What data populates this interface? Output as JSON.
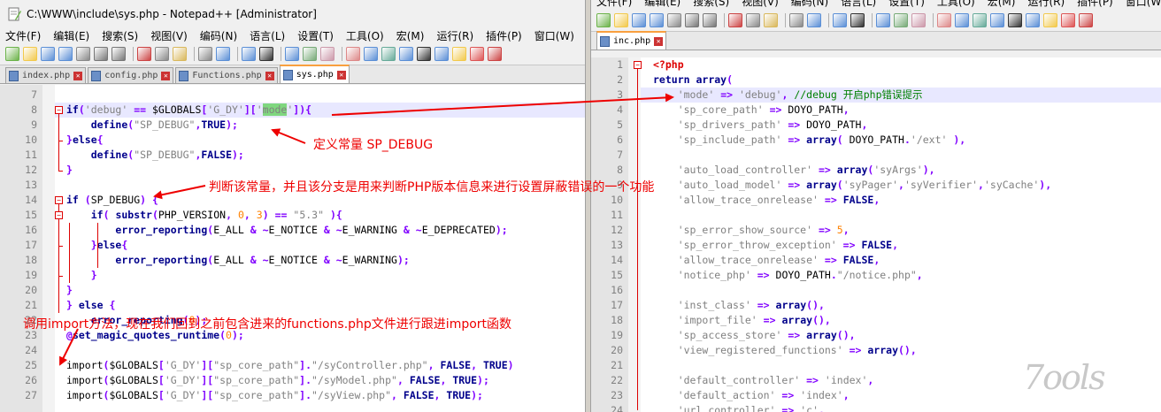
{
  "left_window": {
    "title": "C:\\WWW\\include\\sys.php - Notepad++ [Administrator]",
    "menu": [
      "文件(F)",
      "编辑(E)",
      "搜索(S)",
      "视图(V)",
      "编码(N)",
      "语言(L)",
      "设置(T)",
      "工具(O)",
      "宏(M)",
      "运行(R)",
      "插件(P)",
      "窗口(W)",
      "?"
    ],
    "tabs": [
      "index.php",
      "config.php",
      "Functions.php",
      "sys.php"
    ],
    "active_tab": "sys.php",
    "lines": [
      {
        "n": "7",
        "html": ""
      },
      {
        "n": "8",
        "html": "<span class='kw'>if</span><span class='op'>(</span><span class='st'>'debug'</span> <span class='op'>==</span> $GLOBALS<span class='op'>[</span><span class='st'>'G_DY'</span><span class='op'>][</span><span class='st'>'<span class=\"hl\">mode</span>'</span><span class='op'>]){</span>"
      },
      {
        "n": "9",
        "html": "    <span class='kw'>define</span><span class='op'>(</span><span class='st'>\"SP_DEBUG\"</span><span class='op'>,</span><span class='kw'>TRUE</span><span class='op'>);</span>"
      },
      {
        "n": "10",
        "html": "<span class='op'>}</span><span class='kw'>else</span><span class='op'>{</span>"
      },
      {
        "n": "11",
        "html": "    <span class='kw'>define</span><span class='op'>(</span><span class='st'>\"SP_DEBUG\"</span><span class='op'>,</span><span class='kw'>FALSE</span><span class='op'>);</span>"
      },
      {
        "n": "12",
        "html": "<span class='op'>}</span>"
      },
      {
        "n": "13",
        "html": ""
      },
      {
        "n": "14",
        "html": "<span class='kw'>if</span> <span class='op'>(</span>SP_DEBUG<span class='op'>)</span> <span class='op'>{</span>"
      },
      {
        "n": "15",
        "html": "    <span class='kw'>if</span><span class='op'>(</span> <span class='kw'>substr</span><span class='op'>(</span>PHP_VERSION<span class='op'>,</span> <span class='nm'>0</span><span class='op'>,</span> <span class='nm'>3</span><span class='op'>)</span> <span class='op'>==</span> <span class='st'>\"5.3\"</span> <span class='op'>){</span>"
      },
      {
        "n": "16",
        "html": "        <span class='kw'>error_reporting</span><span class='op'>(</span>E_ALL <span class='op'>&amp;</span> <span class='op'>~</span>E_NOTICE <span class='op'>&amp;</span> <span class='op'>~</span>E_WARNING <span class='op'>&amp;</span> <span class='op'>~</span>E_DEPRECATED<span class='op'>);</span>"
      },
      {
        "n": "17",
        "html": "    <span class='op'>}</span><span class='kw'>else</span><span class='op'>{</span>"
      },
      {
        "n": "18",
        "html": "        <span class='kw'>error_reporting</span><span class='op'>(</span>E_ALL <span class='op'>&amp;</span> <span class='op'>~</span>E_NOTICE <span class='op'>&amp;</span> <span class='op'>~</span>E_WARNING<span class='op'>);</span>"
      },
      {
        "n": "19",
        "html": "    <span class='op'>}</span>"
      },
      {
        "n": "20",
        "html": "<span class='op'>}</span>"
      },
      {
        "n": "21",
        "html": "<span class='op'>}</span> <span class='kw'>else</span> <span class='op'>{</span>"
      },
      {
        "n": "22",
        "html": "    <span class='kw'>error_reporting</span><span class='op'>(</span><span class='nm'>0</span><span class='op'>);</span>"
      },
      {
        "n": "23",
        "html": "<span class='op'>@</span><span class='kw'>set_magic_quotes_runtime</span><span class='op'>(</span><span class='nm'>0</span><span class='op'>);</span>"
      },
      {
        "n": "24",
        "html": ""
      },
      {
        "n": "25",
        "html": "import<span class='op'>(</span>$GLOBALS<span class='op'>[</span><span class='st'>'G_DY'</span><span class='op'>][</span><span class='st'>\"sp_core_path\"</span><span class='op'>].</span><span class='st'>\"/syController.php\"</span><span class='op'>,</span> <span class='kw'>FALSE</span><span class='op'>,</span> <span class='kw'>TRUE</span><span class='op'>)</span>"
      },
      {
        "n": "26",
        "html": "import<span class='op'>(</span>$GLOBALS<span class='op'>[</span><span class='st'>'G_DY'</span><span class='op'>][</span><span class='st'>\"sp_core_path\"</span><span class='op'>].</span><span class='st'>\"/syModel.php\"</span><span class='op'>,</span> <span class='kw'>FALSE</span><span class='op'>,</span> <span class='kw'>TRUE</span><span class='op'>);</span>"
      },
      {
        "n": "27",
        "html": "import<span class='op'>(</span>$GLOBALS<span class='op'>[</span><span class='st'>'G_DY'</span><span class='op'>][</span><span class='st'>\"sp_core_path\"</span><span class='op'>].</span><span class='st'>\"/syView.php\"</span><span class='op'>,</span> <span class='kw'>FALSE</span><span class='op'>,</span> <span class='kw'>TRUE</span><span class='op'>);</span>"
      }
    ]
  },
  "right_window": {
    "menu": [
      "文件(F)",
      "编辑(E)",
      "搜索(S)",
      "视图(V)",
      "编码(N)",
      "语言(L)",
      "设置(T)",
      "工具(O)",
      "宏(M)",
      "运行(R)",
      "插件(P)",
      "窗口(W)"
    ],
    "tabs": [
      "inc.php"
    ],
    "active_tab": "inc.php",
    "lines": [
      {
        "n": "1",
        "html": "<span class='op' style='color:#d00'>&lt;?php</span>"
      },
      {
        "n": "2",
        "html": "<span class='kw'>return</span> <span class='kw'>array</span><span class='op'>(</span>"
      },
      {
        "n": "3",
        "html": "    <span class='st'>'mode'</span> <span class='op'>=&gt;</span> <span class='st'>'debug'</span><span class='op'>,</span> <span class='cm'>//debug 开启php错误提示</span>"
      },
      {
        "n": "4",
        "html": "    <span class='st'>'sp_core_path'</span> <span class='op'>=&gt;</span> DOYO_PATH<span class='op'>,</span>"
      },
      {
        "n": "5",
        "html": "    <span class='st'>'sp_drivers_path'</span> <span class='op'>=&gt;</span> DOYO_PATH<span class='op'>,</span>"
      },
      {
        "n": "6",
        "html": "    <span class='st'>'sp_include_path'</span> <span class='op'>=&gt;</span> <span class='kw'>array</span><span class='op'>(</span> DOYO_PATH<span class='op'>.</span><span class='st'>'/ext'</span> <span class='op'>),</span>"
      },
      {
        "n": "7",
        "html": ""
      },
      {
        "n": "8",
        "html": "    <span class='st'>'auto_load_controller'</span> <span class='op'>=&gt;</span> <span class='kw'>array</span><span class='op'>(</span><span class='st'>'syArgs'</span><span class='op'>),</span>"
      },
      {
        "n": "9",
        "html": "    <span class='st'>'auto_load_model'</span> <span class='op'>=&gt;</span> <span class='kw'>array</span><span class='op'>(</span><span class='st'>'syPager'</span><span class='op'>,</span><span class='st'>'syVerifier'</span><span class='op'>,</span><span class='st'>'syCache'</span><span class='op'>),</span>"
      },
      {
        "n": "10",
        "html": "    <span class='st'>'allow_trace_onrelease'</span> <span class='op'>=&gt;</span> <span class='kw'>FALSE</span><span class='op'>,</span>"
      },
      {
        "n": "11",
        "html": ""
      },
      {
        "n": "12",
        "html": "    <span class='st'>'sp_error_show_source'</span> <span class='op'>=&gt;</span> <span class='nm'>5</span><span class='op'>,</span>"
      },
      {
        "n": "13",
        "html": "    <span class='st'>'sp_error_throw_exception'</span> <span class='op'>=&gt;</span> <span class='kw'>FALSE</span><span class='op'>,</span>"
      },
      {
        "n": "14",
        "html": "    <span class='st'>'allow_trace_onrelease'</span> <span class='op'>=&gt;</span> <span class='kw'>FALSE</span><span class='op'>,</span>"
      },
      {
        "n": "15",
        "html": "    <span class='st'>'notice_php'</span> <span class='op'>=&gt;</span> DOYO_PATH<span class='op'>.</span><span class='st'>\"/notice.php\"</span><span class='op'>,</span>"
      },
      {
        "n": "16",
        "html": ""
      },
      {
        "n": "17",
        "html": "    <span class='st'>'inst_class'</span> <span class='op'>=&gt;</span> <span class='kw'>array</span><span class='op'>(),</span>"
      },
      {
        "n": "18",
        "html": "    <span class='st'>'import_file'</span> <span class='op'>=&gt;</span> <span class='kw'>array</span><span class='op'>(),</span>"
      },
      {
        "n": "19",
        "html": "    <span class='st'>'sp_access_store'</span> <span class='op'>=&gt;</span> <span class='kw'>array</span><span class='op'>(),</span>"
      },
      {
        "n": "20",
        "html": "    <span class='st'>'view_registered_functions'</span> <span class='op'>=&gt;</span> <span class='kw'>array</span><span class='op'>(),</span>"
      },
      {
        "n": "21",
        "html": ""
      },
      {
        "n": "22",
        "html": "    <span class='st'>'default_controller'</span> <span class='op'>=&gt;</span> <span class='st'>'index'</span><span class='op'>,</span>"
      },
      {
        "n": "23",
        "html": "    <span class='st'>'default_action'</span> <span class='op'>=&gt;</span> <span class='st'>'index'</span><span class='op'>,</span>"
      },
      {
        "n": "24",
        "html": "    <span class='st'>'url_controller'</span> <span class='op'>=&gt;</span> <span class='st'>'c'</span><span class='op'>,</span>"
      }
    ]
  },
  "annotations": {
    "define_const": "定义常量 SP_DEBUG",
    "judge_const": "判断该常量，并且该分支是用来判断PHP版本信息来进行设置屏蔽错误的一个功能",
    "import_call": "调用import方法，现在我们回到之前包含进来的functions.php文件进行跟进import函数"
  },
  "watermark": "7ools",
  "colors": {
    "annotation": "#e00000",
    "keyword": "#00008b",
    "string": "#808080",
    "comment": "#008000",
    "operator": "#8000ff",
    "number": "#ff8000",
    "active_tab_accent": "#f9a03f"
  }
}
